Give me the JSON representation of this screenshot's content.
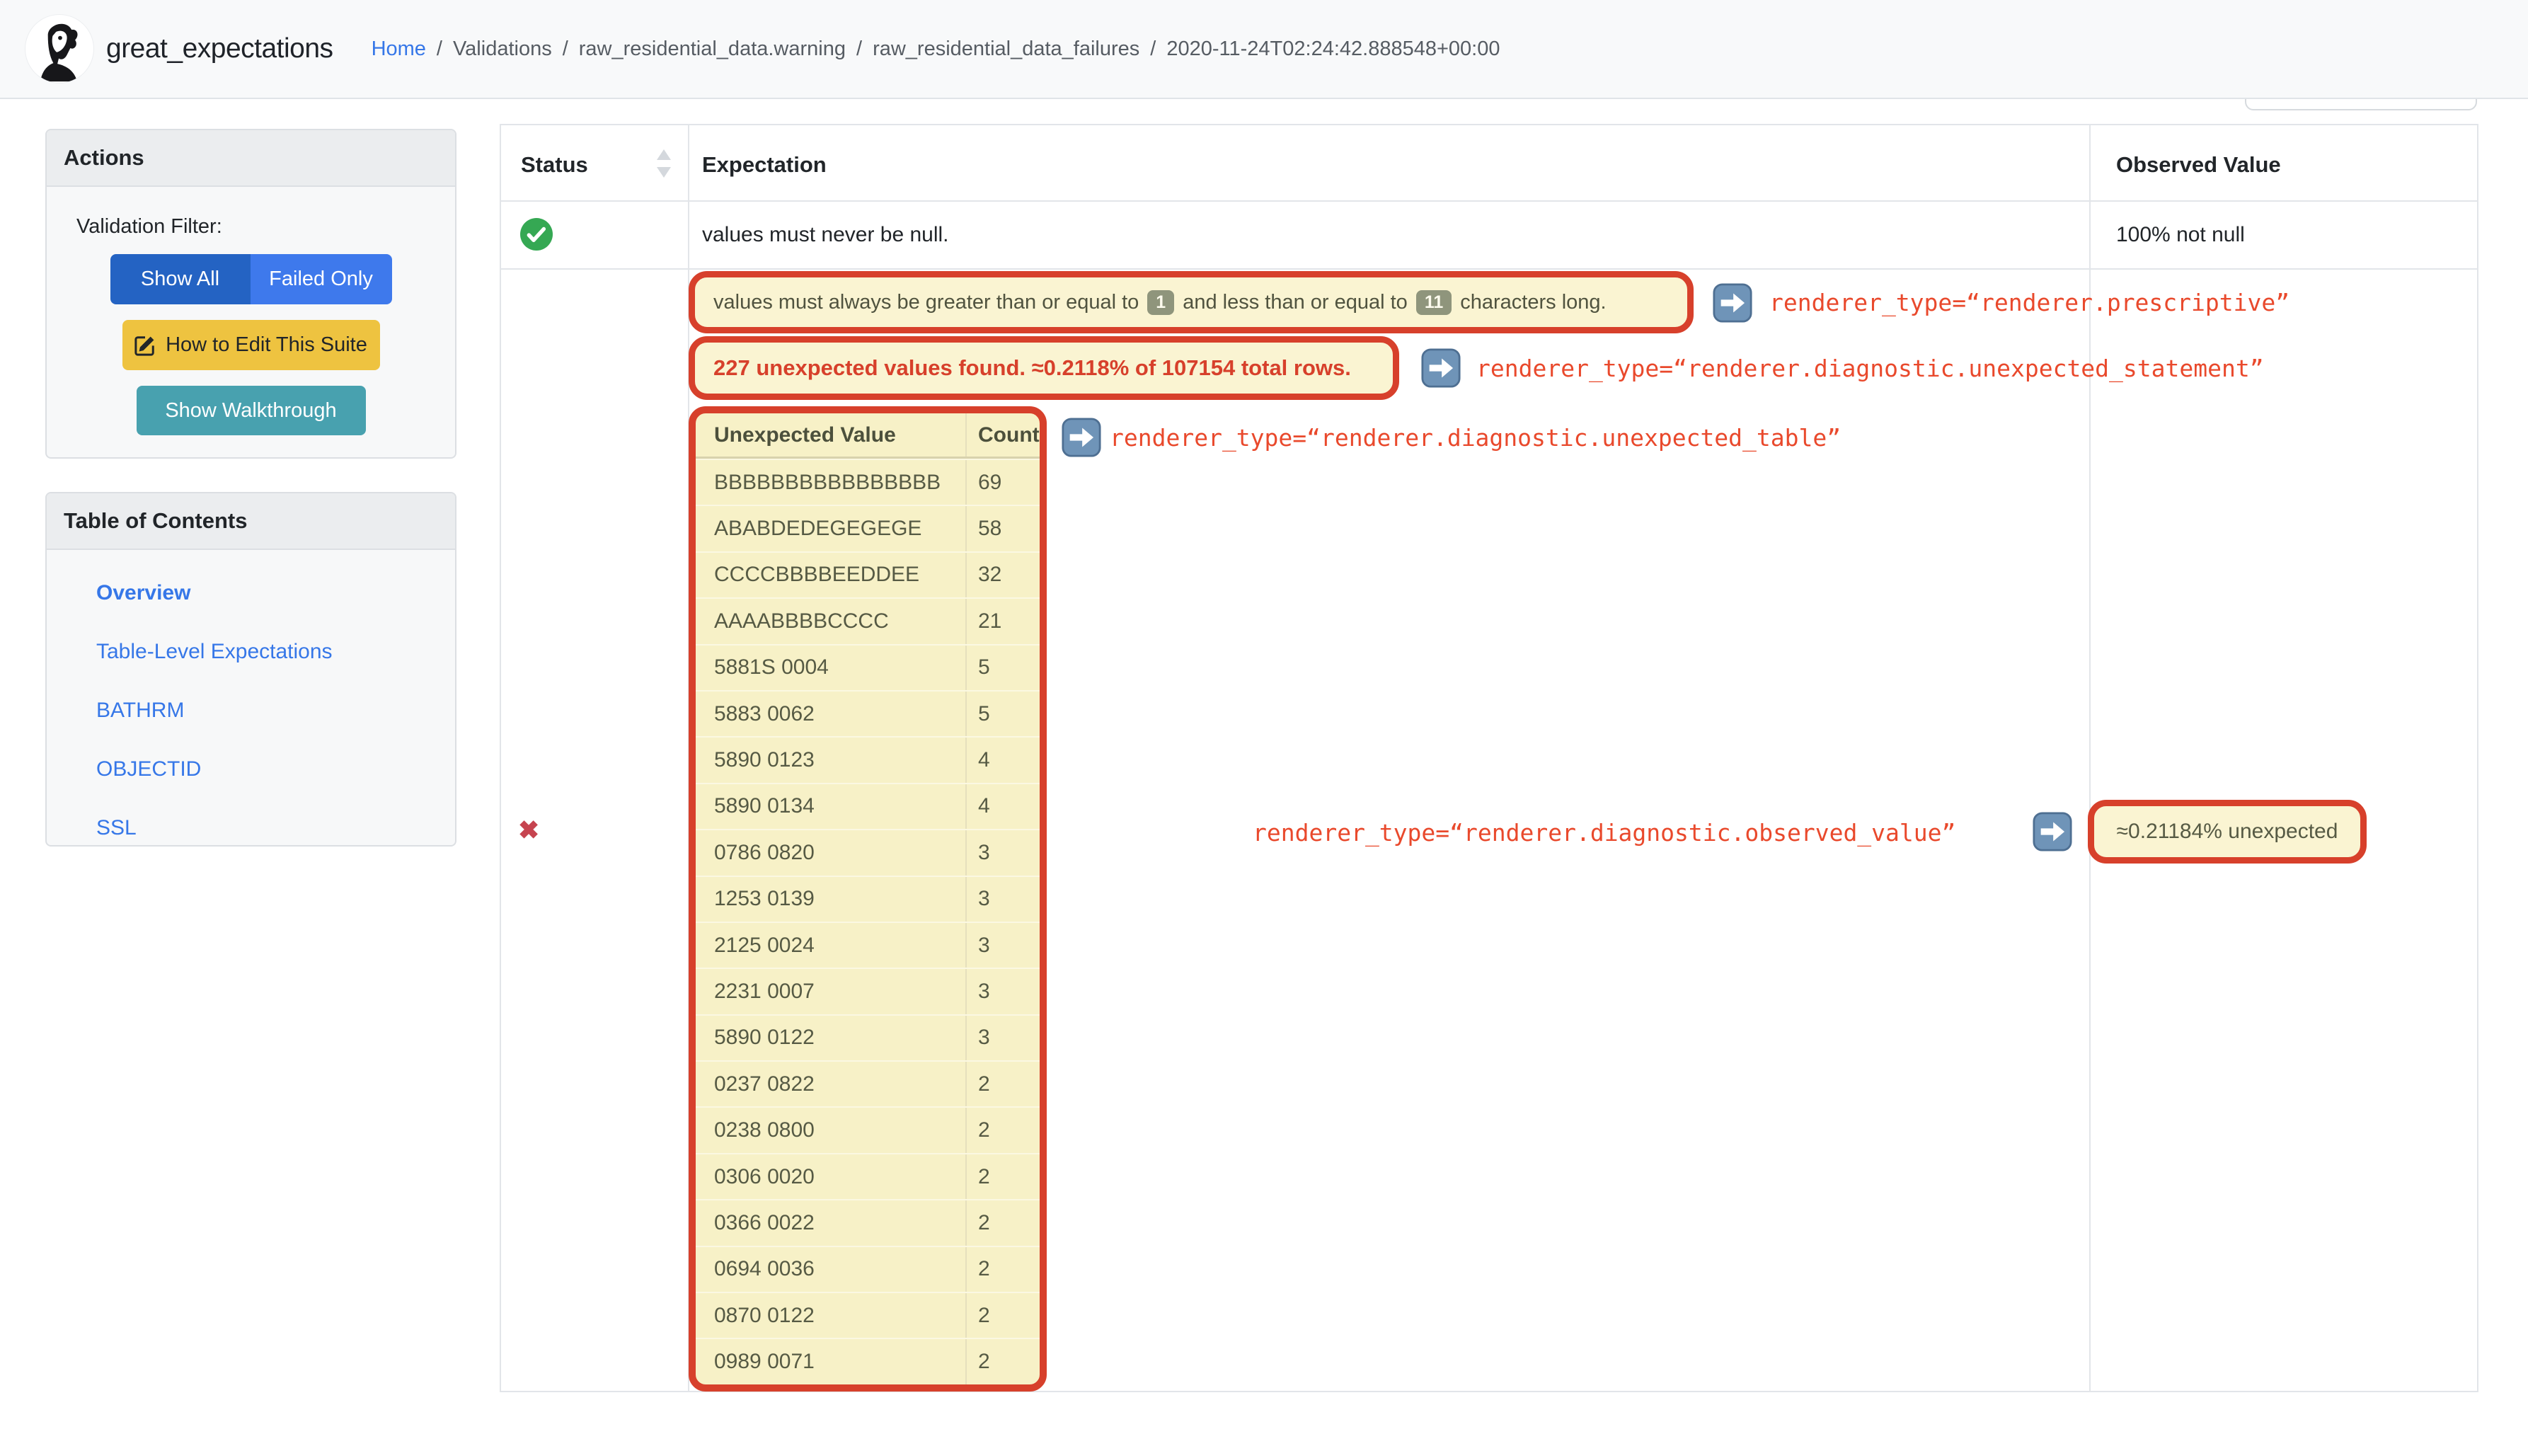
{
  "navbar": {
    "title": "great_expectations",
    "breadcrumb": {
      "home": "Home",
      "segments": [
        {
          "sep": "/",
          "label": "Validations"
        },
        {
          "sep": "/",
          "label": "raw_residential_data.warning"
        },
        {
          "sep": "/",
          "label": "raw_residential_data_failures"
        },
        {
          "sep": "/",
          "label": "2020-11-24T02:24:42.888548+00:00"
        }
      ]
    }
  },
  "sidebar": {
    "actions": {
      "title": "Actions",
      "filter_label": "Validation Filter:",
      "show_all": "Show All",
      "failed_only": "Failed Only",
      "edit_suite": "How to Edit This Suite",
      "walkthrough": "Show Walkthrough"
    },
    "toc": {
      "title": "Table of Contents",
      "items": [
        {
          "label": "Overview"
        },
        {
          "label": "Table-Level Expectations"
        },
        {
          "label": "BATHRM"
        },
        {
          "label": "OBJECTID"
        },
        {
          "label": "SSL"
        }
      ]
    }
  },
  "table": {
    "headers": {
      "status": "Status",
      "expectation": "Expectation",
      "observed": "Observed Value"
    },
    "row1": {
      "expectation": "values must never be null.",
      "observed": "100% not null"
    },
    "row2": {
      "status_icon": "✖"
    }
  },
  "annotations": {
    "box1": {
      "pre": "values must always be greater than or equal to",
      "badge1": "1",
      "mid": "and less than or equal to",
      "badge2": "11",
      "post": "characters long."
    },
    "box2": "227 unexpected values found. ≈0.2118% of 107154 total rows.",
    "renderer_prescriptive": "renderer_type=“renderer.prescriptive”",
    "renderer_unexpected_statement": "renderer_type=“renderer.diagnostic.unexpected_statement”",
    "renderer_unexpected_table": "renderer_type=“renderer.diagnostic.unexpected_table”",
    "renderer_observed_value": "renderer_type=“renderer.diagnostic.observed_value”",
    "observed_box": "≈0.21184% unexpected"
  },
  "unexpected_table": {
    "headers": {
      "value": "Unexpected Value",
      "count": "Count"
    },
    "rows": [
      {
        "value": "BBBBBBBBBBBBBBBB",
        "count": "69"
      },
      {
        "value": "ABABDEDEGEGEGE",
        "count": "58"
      },
      {
        "value": "CCCCBBBBEEDDEE",
        "count": "32"
      },
      {
        "value": "AAAABBBBCCCC",
        "count": "21"
      },
      {
        "value": "5881S 0004",
        "count": "5"
      },
      {
        "value": "5883 0062",
        "count": "5"
      },
      {
        "value": "5890 0123",
        "count": "4"
      },
      {
        "value": "5890 0134",
        "count": "4"
      },
      {
        "value": "0786 0820",
        "count": "3"
      },
      {
        "value": "1253 0139",
        "count": "3"
      },
      {
        "value": "2125 0024",
        "count": "3"
      },
      {
        "value": "2231 0007",
        "count": "3"
      },
      {
        "value": "5890 0122",
        "count": "3"
      },
      {
        "value": "0237 0822",
        "count": "2"
      },
      {
        "value": "0238 0800",
        "count": "2"
      },
      {
        "value": "0306 0020",
        "count": "2"
      },
      {
        "value": "0366 0022",
        "count": "2"
      },
      {
        "value": "0694 0036",
        "count": "2"
      },
      {
        "value": "0870 0122",
        "count": "2"
      },
      {
        "value": "0989 0071",
        "count": "2"
      }
    ]
  },
  "colors": {
    "annotation_red": "#d7402b",
    "annotation_text_red": "#e9492c",
    "highlight_yellow": "#faf4d2",
    "link_blue": "#3677e8",
    "success_green": "#35a853",
    "danger_red": "#c6434f",
    "btn_show_all": "#2463c3",
    "btn_failed_only": "#3e79ec",
    "btn_edit": "#eec340",
    "btn_walkthrough": "#48a1af"
  }
}
